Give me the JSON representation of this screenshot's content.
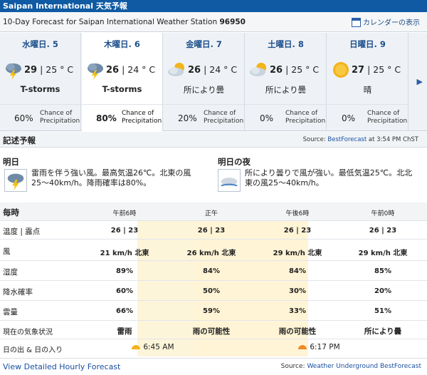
{
  "header": {
    "title": "Saipan International 天気予報",
    "subtitle_prefix": "10-Day Forecast for Saipan International Weather Station ",
    "station_id": "96950",
    "calendar_link": "カレンダーの表示"
  },
  "days": [
    {
      "name": "水曜日. 5",
      "hi": "29",
      "lo": "| 25 ° C",
      "cond": "T-storms",
      "icon": "tstorm-icon",
      "pct": "60%",
      "chance": "Chance of Precipitation"
    },
    {
      "name": "木曜日. 6",
      "hi": "26",
      "lo": "| 24 ° C",
      "cond": "T-storms",
      "icon": "tstorm-icon",
      "pct": "80%",
      "chance": "Chance of Precipitation"
    },
    {
      "name": "金曜日. 7",
      "hi": "26",
      "lo": "| 24 ° C",
      "cond": "所により曇",
      "icon": "partly-cloudy-icon",
      "pct": "20%",
      "chance": "Chance of Precipitation"
    },
    {
      "name": "土曜日. 8",
      "hi": "26",
      "lo": "| 25 ° C",
      "cond": "所により曇",
      "icon": "partly-cloudy-icon",
      "pct": "0%",
      "chance": "Chance of Precipitation"
    },
    {
      "name": "日曜日. 9",
      "hi": "27",
      "lo": "| 25 ° C",
      "cond": "晴",
      "icon": "sun-icon",
      "pct": "0%",
      "chance": "Chance of Precipitation"
    }
  ],
  "chance_l1": "Chance of",
  "chance_l2": "Precipitation",
  "next_arrow": "▶",
  "text_forecast": {
    "heading": "記述予報",
    "source_prefix": "Source: ",
    "source_name": "BestForecast",
    "source_suffix": " at 3:54 PM ChST",
    "tomorrow_title": "明日",
    "tomorrow_text": "雷雨を伴う強い風。最高気温26℃。北東の風25～40km/h。降雨確率は80%。",
    "tomorrow_night_title": "明日の夜",
    "tomorrow_night_text": "所により曇りで風が強い。最低気温25℃。北北東の風25～40km/h。"
  },
  "hourly": {
    "label": "毎時",
    "times": [
      "午前6時",
      "正午",
      "午後6時",
      "午前0時"
    ],
    "rows": [
      {
        "label": "温度 | 露点",
        "values": [
          "26 | 23",
          "26 | 23",
          "26 | 23",
          "26 | 23"
        ]
      },
      {
        "label": "風",
        "values": [
          "21 km/h 北東",
          "26 km/h 北東",
          "29 km/h 北東",
          "29 km/h 北東"
        ]
      },
      {
        "label": "湿度",
        "values": [
          "89%",
          "84%",
          "84%",
          "85%"
        ]
      },
      {
        "label": "降水確率",
        "values": [
          "60%",
          "50%",
          "30%",
          "20%"
        ]
      },
      {
        "label": "雲量",
        "values": [
          "66%",
          "59%",
          "33%",
          "51%"
        ]
      },
      {
        "label": "現在の気象状況",
        "values": [
          "雷雨",
          "雨の可能性",
          "雨の可能性",
          "所により曇"
        ]
      }
    ],
    "sun_label": "日の出 & 日の入り",
    "sunrise": "6:45 AM",
    "sunset": "6:17 PM"
  },
  "footer": {
    "link": "View Detailed Hourly Forecast",
    "source_prefix": "Source: ",
    "source_name": "Weather Underground BestForecast"
  }
}
